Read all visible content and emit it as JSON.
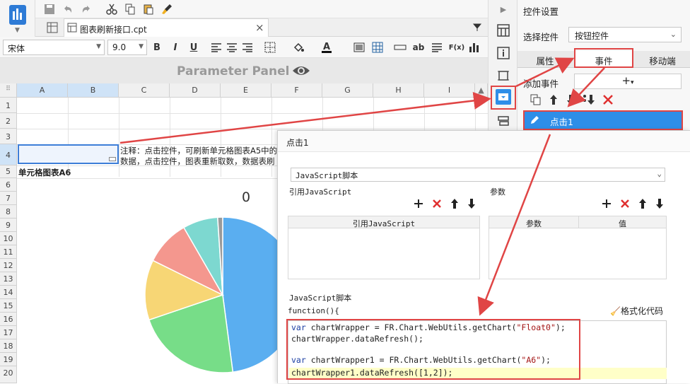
{
  "toolbar": {
    "file_tab": "图表刷新接口.cpt",
    "close": "×"
  },
  "format": {
    "font": "宋体",
    "size": "9.0",
    "bold": "B",
    "italic": "I",
    "underline": "U",
    "ab": "ab",
    "fx": "F(x)"
  },
  "param_panel": {
    "label": "Parameter Panel"
  },
  "grid": {
    "columns": [
      "A",
      "B",
      "C",
      "D",
      "E",
      "F",
      "G",
      "H",
      "I"
    ],
    "rows": [
      "1",
      "2",
      "3",
      "4",
      "5",
      "6",
      "7",
      "8",
      "9",
      "10",
      "11",
      "12",
      "13",
      "14",
      "15",
      "16",
      "17",
      "18",
      "19",
      "20"
    ],
    "note_line1": "注释：点击控件，可刷新单元格图表A5中的",
    "note_line2": "数据，点击控件，图表重新取数，数据表刷",
    "chart_cell_label": "单元格图表A6",
    "chart_value": "0"
  },
  "chart_data": {
    "type": "pie",
    "slices": [
      {
        "value": 46,
        "color": "#5aaef0"
      },
      {
        "value": 21,
        "color": "#77dd88"
      },
      {
        "value": 12,
        "color": "#f7d675"
      },
      {
        "value": 9,
        "color": "#f4978e"
      },
      {
        "value": 7,
        "color": "#7dd8d0"
      },
      {
        "value": 1,
        "color": "#9a9a9a"
      }
    ]
  },
  "settings": {
    "title": "控件设置",
    "select_label": "选择控件",
    "select_value": "按钮控件",
    "tabs": [
      "属性",
      "事件",
      "移动端"
    ],
    "add_event": "添加事件",
    "add_symbol": "+",
    "event_item": "点击1"
  },
  "dialog": {
    "title": "点击1",
    "type": "JavaScript脚本",
    "ref_js": "引用JavaScript",
    "ref_js_col": "引用JavaScript",
    "params": "参数",
    "param_col": "参数",
    "value_col": "值",
    "js_section": "JavaScript脚本",
    "func_open": "function(){",
    "format_code": "格式化代码",
    "code": {
      "l1a": "var",
      "l1b": " chartWrapper = FR.Chart.WebUtils.getChart(",
      "l1c": "\"Float0\"",
      "l1d": ");",
      "l2": "chartWrapper.dataRefresh();",
      "l4a": "var",
      "l4b": " chartWrapper1 = FR.Chart.WebUtils.getChart(",
      "l4c": "\"A6\"",
      "l4d": ");",
      "l5": "chartWrapper1.dataRefresh([1,2]);"
    }
  },
  "colors": {
    "accent": "#2e8ee8",
    "red": "#e04545"
  }
}
